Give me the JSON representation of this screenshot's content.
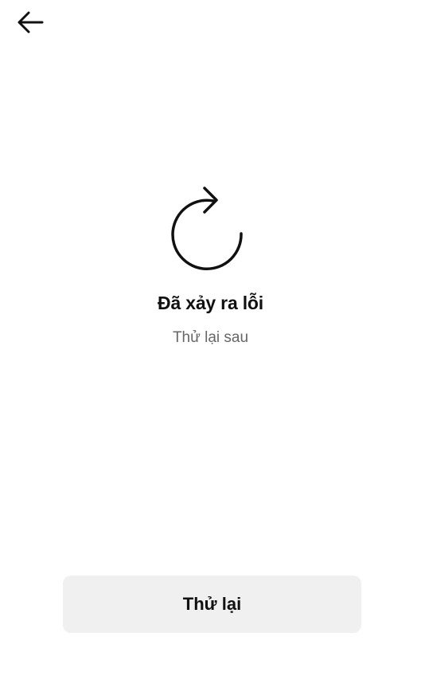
{
  "header": {
    "back_icon": "arrow-left-icon"
  },
  "error": {
    "icon": "refresh-icon",
    "title": "Đã xảy ra lỗi",
    "subtitle": "Thử lại sau"
  },
  "actions": {
    "retry_label": "Thử lại"
  },
  "colors": {
    "background": "#ffffff",
    "text": "#111111",
    "subtext": "#666666",
    "button_bg": "#f0f0f0"
  }
}
